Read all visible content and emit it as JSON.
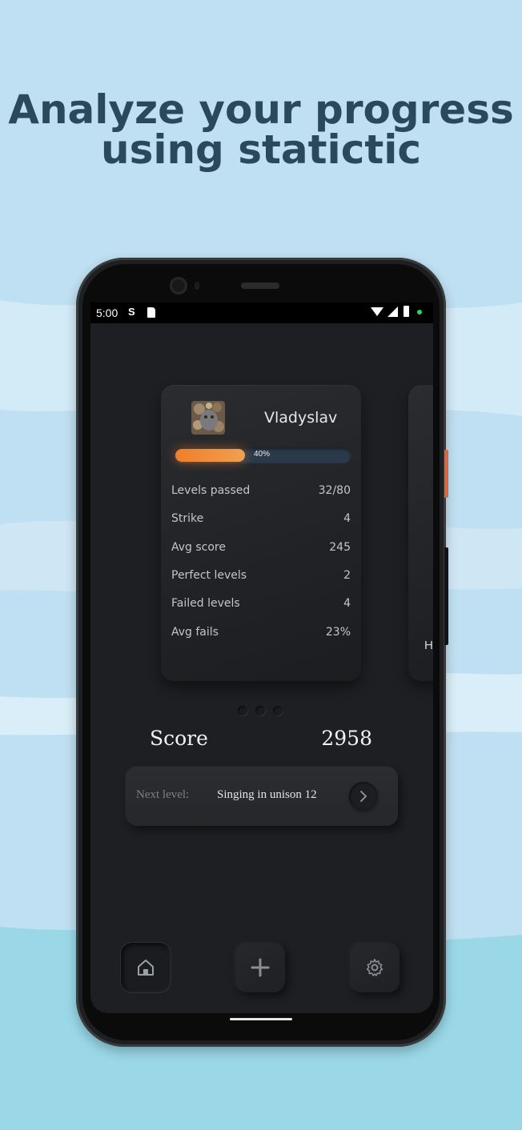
{
  "headline": {
    "line1": "Analyze your progress",
    "line2": "using statictic"
  },
  "statusbar": {
    "time": "5:00",
    "s_icon": "S"
  },
  "profile": {
    "name": "Vladyslav",
    "progress_label": "40%",
    "progress_fraction": 0.4,
    "stats": [
      {
        "label": "Levels passed",
        "value": "32/80"
      },
      {
        "label": "Strike",
        "value": "4"
      },
      {
        "label": "Avg score",
        "value": "245"
      },
      {
        "label": "Perfect levels",
        "value": "2"
      },
      {
        "label": "Failed levels",
        "value": "4"
      },
      {
        "label": "Avg fails",
        "value": "23%"
      }
    ]
  },
  "next_card_peek_letter": "H",
  "score": {
    "label": "Score",
    "value": "2958"
  },
  "next_level": {
    "label": "Next level:",
    "value": "Singing in unison 12"
  },
  "nav": {
    "items": [
      {
        "icon": "home-icon",
        "active": true
      },
      {
        "icon": "plus-icon",
        "active": false
      },
      {
        "icon": "gear-icon",
        "active": false
      }
    ]
  },
  "colors": {
    "background": "#bfe0f2",
    "headline": "#2a4a5c",
    "progress": "#f07e2a",
    "screen": "#1d1f22"
  }
}
